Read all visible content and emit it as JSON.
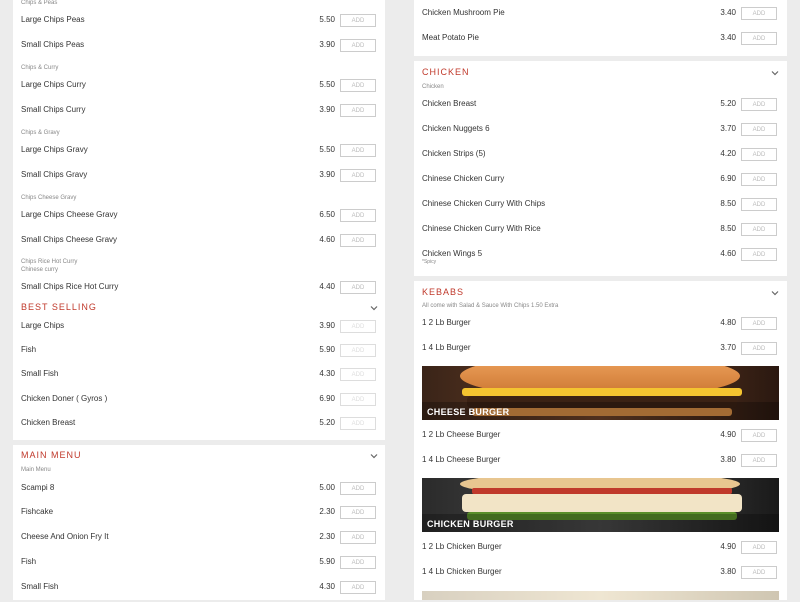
{
  "left": {
    "top_list": {
      "groups": [
        {
          "label": "Chips & Peas",
          "items": [
            {
              "name": "Large Chips Peas",
              "price": "5.50"
            },
            {
              "name": "Small Chips Peas",
              "price": "3.90"
            }
          ]
        },
        {
          "label": "Chips & Curry",
          "items": [
            {
              "name": "Large Chips Curry",
              "price": "5.50"
            },
            {
              "name": "Small Chips Curry",
              "price": "3.90"
            }
          ]
        },
        {
          "label": "Chips & Gravy",
          "items": [
            {
              "name": "Large Chips Gravy",
              "price": "5.50"
            },
            {
              "name": "Small Chips Gravy",
              "price": "3.90"
            }
          ]
        },
        {
          "label": "Chips Cheese Gravy",
          "items": [
            {
              "name": "Large Chips Cheese Gravy",
              "price": "6.50"
            },
            {
              "name": "Small Chips Cheese Gravy",
              "price": "4.60"
            }
          ]
        },
        {
          "label": "Chips Rice Hot Curry",
          "sublabel": "Chinese curry",
          "items": [
            {
              "name": "Small Chips Rice Hot Curry",
              "price": "4.40"
            }
          ]
        }
      ]
    },
    "best_selling": {
      "title": "BEST SELLING",
      "items": [
        {
          "name": "Large Chips",
          "price": "3.90"
        },
        {
          "name": "Fish",
          "price": "5.90"
        },
        {
          "name": "Small Fish",
          "price": "4.30"
        },
        {
          "name": "Chicken Doner ( Gyros )",
          "price": "6.90"
        },
        {
          "name": "Chicken Breast",
          "price": "5.20"
        }
      ]
    },
    "main_menu": {
      "title": "MAIN MENU",
      "subtitle": "Main Menu",
      "items": [
        {
          "name": "Scampi 8",
          "price": "5.00"
        },
        {
          "name": "Fishcake",
          "price": "2.30"
        },
        {
          "name": "Cheese And Onion Fry It",
          "price": "2.30"
        },
        {
          "name": "Fish",
          "price": "5.90"
        },
        {
          "name": "Small Fish",
          "price": "4.30"
        }
      ]
    }
  },
  "right": {
    "pies": {
      "items": [
        {
          "name": "Chicken Mushroom Pie",
          "price": "3.40"
        },
        {
          "name": "Meat Potato Pie",
          "price": "3.40"
        }
      ]
    },
    "chicken": {
      "title": "CHICKEN",
      "subtitle": "Chicken",
      "items": [
        {
          "name": "Chicken Breast",
          "price": "5.20"
        },
        {
          "name": "Chicken Nuggets 6",
          "price": "3.70"
        },
        {
          "name": "Chicken Strips (5)",
          "price": "4.20"
        },
        {
          "name": "Chinese Chicken Curry",
          "price": "6.90"
        },
        {
          "name": "Chinese Chicken Curry With Chips",
          "price": "8.50"
        },
        {
          "name": "Chinese Chicken Curry With Rice",
          "price": "8.50"
        },
        {
          "name": "Chicken Wings 5",
          "price": "4.60",
          "note": "*Spicy"
        }
      ]
    },
    "kebabs": {
      "title": "KEBABS",
      "subtitle": "All come with Salad & Sauce With Chips 1.50 Extra",
      "items_a": [
        {
          "name": "1 2 Lb Burger",
          "price": "4.80"
        },
        {
          "name": "1 4 Lb Burger",
          "price": "3.70"
        }
      ],
      "banner1": "CHEESE BURGER",
      "items_b": [
        {
          "name": "1 2 Lb Cheese Burger",
          "price": "4.90"
        },
        {
          "name": "1 4 Lb Cheese Burger",
          "price": "3.80"
        }
      ],
      "banner2": "CHICKEN BURGER",
      "items_c": [
        {
          "name": "1 2 Lb Chicken Burger",
          "price": "4.90"
        },
        {
          "name": "1 4 Lb Chicken Burger",
          "price": "3.80"
        }
      ]
    }
  },
  "add_label": "ADD",
  "colors": {
    "accent": "#c0392b",
    "bg": "#ececec",
    "panel": "#ffffff"
  }
}
